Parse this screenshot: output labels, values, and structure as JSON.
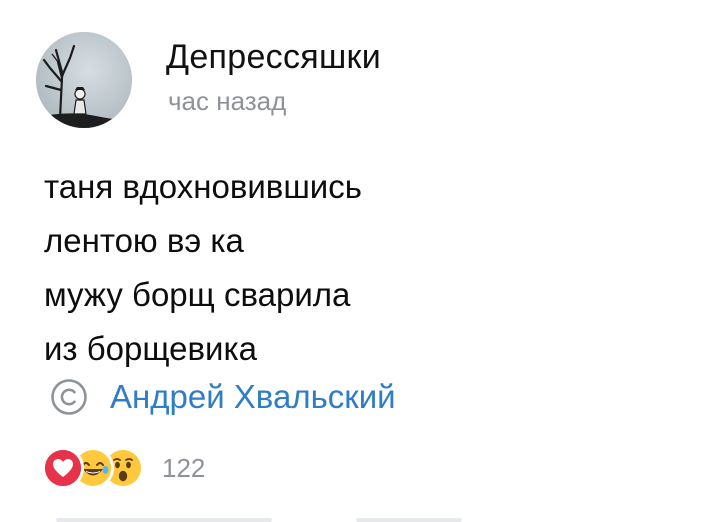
{
  "post": {
    "group_name": "Депрессяшки",
    "time": "час назад",
    "text_lines": [
      "таня вдохновившись",
      "лентою вэ ка",
      "мужу борщ сварила",
      "из борщевика"
    ],
    "copyright_icon": "copyright-icon",
    "author": "Андрей Хвальский",
    "reactions": {
      "icons": [
        "heart-reaction-icon",
        "laughing-tears-reaction-icon",
        "surprised-reaction-icon"
      ],
      "count": "122"
    }
  },
  "colors": {
    "link": "#2f7dc7",
    "secondary_text": "#8e9399",
    "heart": "#e6334b",
    "emoji_yellow": "#ffc83d"
  }
}
